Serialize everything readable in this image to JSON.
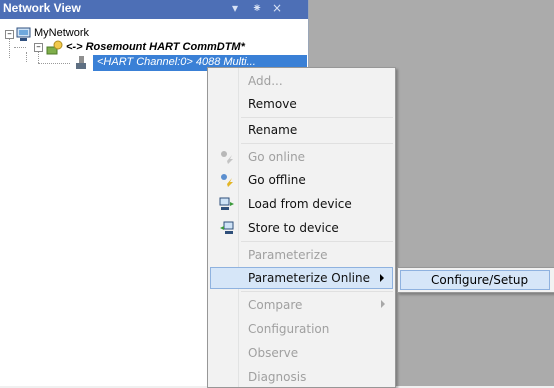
{
  "panel": {
    "title": "Network View",
    "controls": {
      "pin": "↕",
      "close": "×"
    }
  },
  "tree": {
    "root": "MyNetwork",
    "dtm": "<-> Rosemount HART CommDTM*",
    "channel": "<HART Channel:0> 4088 Multi..."
  },
  "menu": {
    "items": [
      {
        "label": "Add...",
        "disabled": true
      },
      {
        "label": "Remove",
        "disabled": false
      },
      {
        "label": "Rename",
        "disabled": false
      },
      {
        "label": "Go online",
        "disabled": true,
        "icon": "go-online-icon"
      },
      {
        "label": "Go offline",
        "disabled": false,
        "icon": "go-offline-icon"
      },
      {
        "label": "Load from device",
        "disabled": false,
        "icon": "load-from-device-icon"
      },
      {
        "label": "Store to device",
        "disabled": false,
        "icon": "store-to-device-icon"
      },
      {
        "label": "Parameterize",
        "disabled": true
      },
      {
        "label": "Parameterize Online",
        "disabled": false,
        "submenu": true,
        "highlighted": true
      },
      {
        "label": "Compare",
        "disabled": true,
        "submenu": true
      },
      {
        "label": "Configuration",
        "disabled": true
      },
      {
        "label": "Observe",
        "disabled": true
      },
      {
        "label": "Diagnosis",
        "disabled": true
      }
    ]
  },
  "submenu": {
    "items": [
      {
        "label": "Configure/Setup"
      }
    ]
  },
  "colors": {
    "titlebar": "#4d6fb6",
    "selection": "#3a80d6",
    "menu_highlight": "#d6e6f8",
    "background_grey": "#ababab"
  }
}
